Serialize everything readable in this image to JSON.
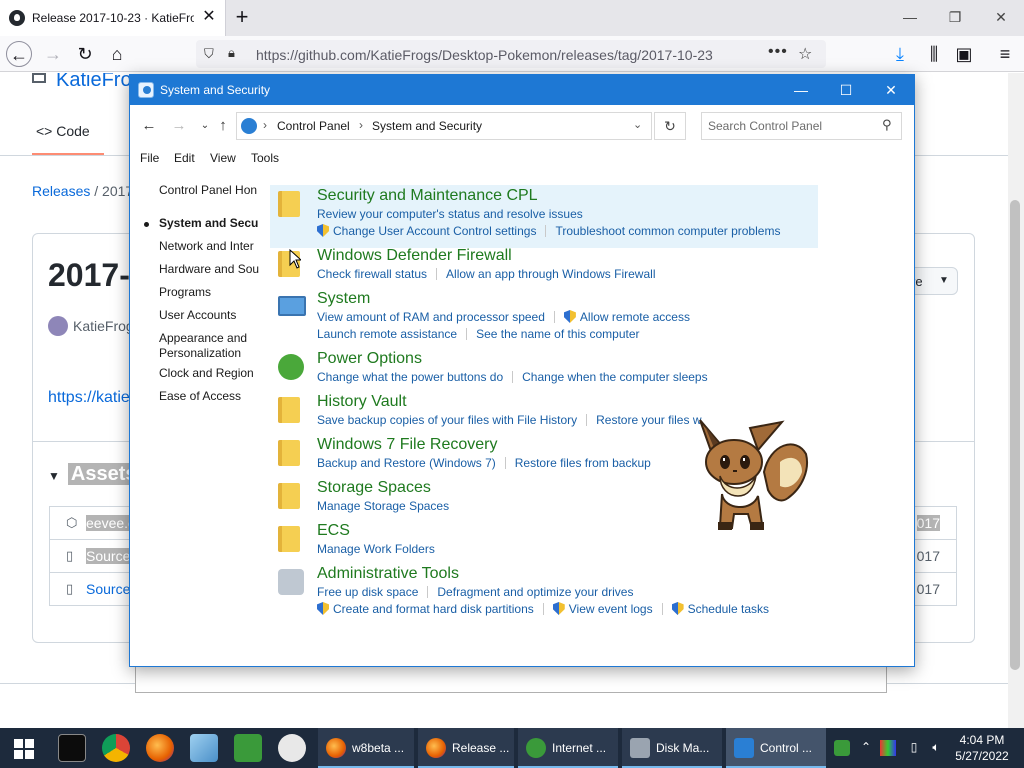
{
  "browser": {
    "tab_title": "Release 2017-10-23 · KatieFrogs",
    "tab_close": "✕",
    "new_tab": "+",
    "url": "https://github.com/KatieFrogs/Desktop-Pokemon/releases/tag/2017-10-23"
  },
  "github": {
    "repo_link": "KatieFro",
    "code_tab": "Code",
    "breadcrumb_releases": "Releases",
    "breadcrumb_current": "/ 2017",
    "release_title": "2017-",
    "author": "KatieFrog",
    "link_text": "https://katie",
    "assets_heading": "Assets",
    "compare_label": "re",
    "asset_rows": [
      {
        "name": "eevee.e",
        "date": "017"
      },
      {
        "name": "Source",
        "date": "017"
      },
      {
        "name": "Source",
        "date": "017"
      }
    ]
  },
  "control_panel": {
    "window_title": "System and Security",
    "address": {
      "crumbs": [
        "Control Panel",
        "System and Security"
      ]
    },
    "search_placeholder": "Search Control Panel",
    "menus": [
      "File",
      "Edit",
      "View",
      "Tools"
    ],
    "left_nav": [
      "Control Panel Hon",
      "System and Secu",
      "Network and Inter",
      "Hardware and Sou",
      "Programs",
      "User Accounts",
      "Appearance and",
      "Personalization",
      "Clock and Region",
      "Ease of Access"
    ],
    "categories": [
      {
        "title": "Security and Maintenance CPL",
        "icon": "folder-icon",
        "rows": [
          [
            {
              "text": "Review your computer's status and resolve issues",
              "uac": false
            }
          ],
          [
            {
              "text": "Change User Account Control settings",
              "uac": true
            },
            {
              "text": "Troubleshoot common computer problems",
              "uac": false
            }
          ]
        ]
      },
      {
        "title": "Windows Defender Firewall",
        "icon": "folder-icon",
        "rows": [
          [
            {
              "text": "Check firewall status",
              "uac": false
            },
            {
              "text": "Allow an app through Windows Firewall",
              "uac": false
            }
          ]
        ]
      },
      {
        "title": "System",
        "icon": "computer-icon",
        "rows": [
          [
            {
              "text": "View amount of RAM and processor speed",
              "uac": false
            },
            {
              "text": "Allow remote access",
              "uac": true
            }
          ],
          [
            {
              "text": "Launch remote assistance",
              "uac": false
            },
            {
              "text": "See the name of this computer",
              "uac": false
            }
          ]
        ]
      },
      {
        "title": "Power Options",
        "icon": "battery-icon",
        "rows": [
          [
            {
              "text": "Change what the power buttons do",
              "uac": false
            },
            {
              "text": "Change when the computer sleeps",
              "uac": false
            }
          ]
        ]
      },
      {
        "title": "History Vault",
        "icon": "folder-icon",
        "rows": [
          [
            {
              "text": "Save backup copies of your files with File History",
              "uac": false
            },
            {
              "text": "Restore your files w",
              "uac": false
            }
          ]
        ]
      },
      {
        "title": "Windows 7 File Recovery",
        "icon": "folder-icon",
        "rows": [
          [
            {
              "text": "Backup and Restore (Windows 7)",
              "uac": false
            },
            {
              "text": "Restore files from backup",
              "uac": false
            }
          ]
        ]
      },
      {
        "title": "Storage Spaces",
        "icon": "folder-icon",
        "rows": [
          [
            {
              "text": "Manage Storage Spaces",
              "uac": false
            }
          ]
        ]
      },
      {
        "title": "ECS",
        "icon": "folder-icon",
        "rows": [
          [
            {
              "text": "Manage Work Folders",
              "uac": false
            }
          ]
        ]
      },
      {
        "title": "Administrative Tools",
        "icon": "admin-tools-icon",
        "rows": [
          [
            {
              "text": "Free up disk space",
              "uac": false
            },
            {
              "text": "Defragment and optimize your drives",
              "uac": false
            }
          ],
          [
            {
              "text": "Create and format hard disk partitions",
              "uac": true
            },
            {
              "text": "View event logs",
              "uac": true
            },
            {
              "text": "Schedule tasks",
              "uac": true
            }
          ]
        ]
      }
    ]
  },
  "taskbar": {
    "apps": [
      {
        "label": "w8beta ...",
        "icon": "firefox-icon",
        "color": "#e66000",
        "active": false
      },
      {
        "label": "Release ...",
        "icon": "firefox-icon",
        "color": "#e66000",
        "active": false
      },
      {
        "label": "Internet ...",
        "icon": "internet-options-icon",
        "color": "#3a9a3a",
        "active": false
      },
      {
        "label": "Disk Ma...",
        "icon": "disk-management-icon",
        "color": "#9aa4b0",
        "active": false
      },
      {
        "label": "Control ...",
        "icon": "control-panel-icon",
        "color": "#2a7fd4",
        "active": true
      }
    ],
    "time": "4:04 PM",
    "date": "5/27/2022"
  }
}
